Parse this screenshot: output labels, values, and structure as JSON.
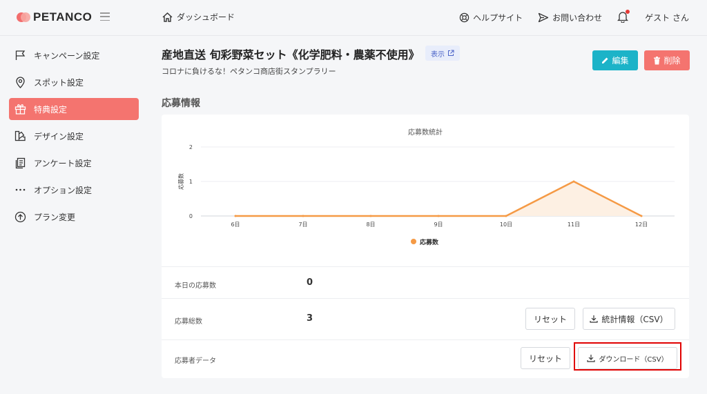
{
  "brand": {
    "name": "PETANCO"
  },
  "header": {
    "breadcrumb": "ダッシュボード",
    "help": "ヘルプサイト",
    "contact": "お問い合わせ",
    "user": "ゲスト さん"
  },
  "sidebar": {
    "items": [
      {
        "label": "キャンペーン設定",
        "icon": "flag-icon"
      },
      {
        "label": "スポット設定",
        "icon": "map-pin-icon"
      },
      {
        "label": "特典設定",
        "icon": "gift-icon",
        "active": true
      },
      {
        "label": "デザイン設定",
        "icon": "palette-icon"
      },
      {
        "label": "アンケート設定",
        "icon": "clipboard-icon"
      },
      {
        "label": "オプション設定",
        "icon": "more-icon"
      },
      {
        "label": "プラン変更",
        "icon": "arrow-up-circle-icon"
      }
    ]
  },
  "main": {
    "title": "産地直送 旬彩野菜セット《化学肥料・農薬不使用》",
    "view_badge": "表示",
    "subtitle": "コロナに負けるな！ペタンコ商店街スタンプラリー",
    "edit_button": "編集",
    "delete_button": "削除",
    "section_title": "応募情報"
  },
  "chart_data": {
    "type": "area",
    "title": "応募数統計",
    "ylabel": "応募数",
    "xlabel": "",
    "categories": [
      "6日",
      "7日",
      "8日",
      "9日",
      "10日",
      "11日",
      "12日"
    ],
    "series": [
      {
        "name": "応募数",
        "values": [
          0,
          0,
          0,
          0,
          0,
          1,
          0
        ]
      }
    ],
    "ylim": [
      0,
      2
    ],
    "yticks": [
      0,
      1,
      2
    ],
    "grid": true,
    "legend": "bottom",
    "colors": {
      "line": "#f59a45",
      "fill": "#fdf0e3"
    }
  },
  "stats": {
    "today_label": "本日の応募数",
    "today_value": "0",
    "total_label": "応募総数",
    "total_value": "3",
    "reset_label": "リセット",
    "stats_csv": "統計情報（CSV）",
    "applicant_label": "応募者データ",
    "download_csv": "ダウンロード（CSV）"
  },
  "colors": {
    "accent": "#f4746f",
    "edit": "#1cb3c8",
    "highlight": "#e00000"
  }
}
